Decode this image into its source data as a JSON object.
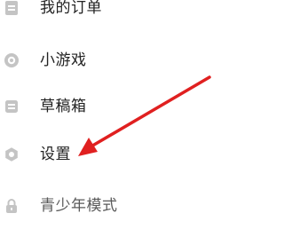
{
  "menu": {
    "items": [
      {
        "label": "我的订单",
        "icon": "orders-icon"
      },
      {
        "label": "小游戏",
        "icon": "mini-game-icon"
      },
      {
        "label": "草稿箱",
        "icon": "drafts-icon"
      },
      {
        "label": "设置",
        "icon": "gear-icon"
      },
      {
        "label": "青少年模式",
        "icon": "lock-icon"
      }
    ]
  },
  "colors": {
    "icon_gray": "#c4c4c4",
    "text": "#222222",
    "annotation_arrow": "#e02020"
  }
}
